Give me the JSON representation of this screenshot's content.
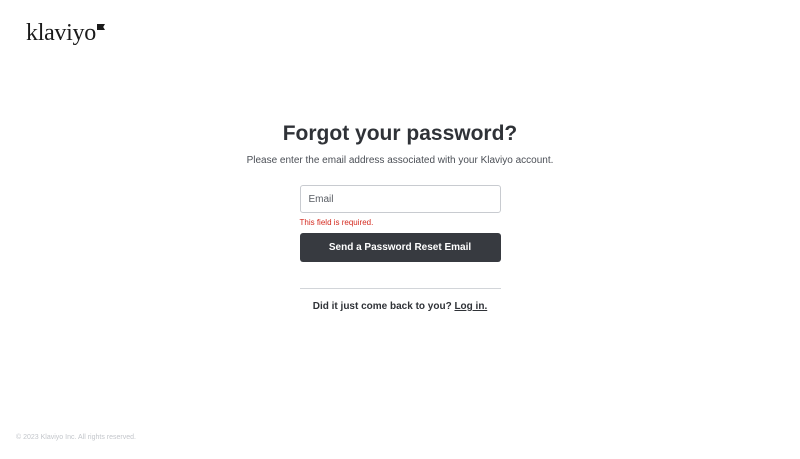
{
  "brand": {
    "logo_text": "klaviyo",
    "flag_color": "#1a1a1a"
  },
  "page": {
    "title": "Forgot your password?",
    "subtitle": "Please enter the email address associated with your Klaviyo account."
  },
  "form": {
    "email_placeholder": "Email",
    "email_value": "",
    "error_text": "This field is required.",
    "submit_label": "Send a Password Reset Email"
  },
  "login": {
    "prompt": "Did it just come back to you?",
    "link_label": "Log in."
  },
  "footer": {
    "copyright": "© 2023 Klaviyo Inc. All rights reserved."
  },
  "colors": {
    "button_bg": "#373a40",
    "error": "#d42a1f",
    "text": "#2f3237"
  }
}
